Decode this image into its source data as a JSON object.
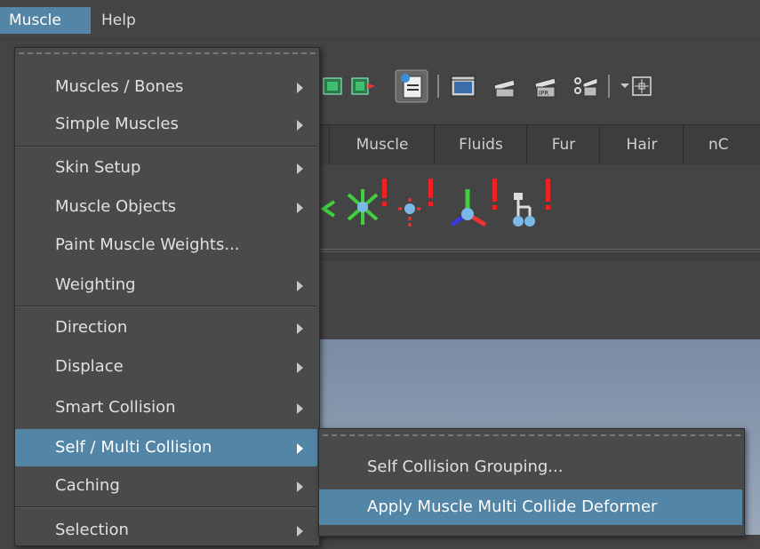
{
  "menubar": {
    "items": [
      {
        "label": "Muscle",
        "active": true
      },
      {
        "label": "Help",
        "active": false
      }
    ]
  },
  "shelf": {
    "tabs": [
      "Muscle",
      "Fluids",
      "Fur",
      "Hair",
      "nC"
    ]
  },
  "menu": {
    "items": [
      {
        "label": "Muscles / Bones",
        "submenu": true
      },
      {
        "label": "Simple Muscles",
        "submenu": true
      },
      {
        "label": "Skin Setup",
        "submenu": true
      },
      {
        "label": "Muscle Objects",
        "submenu": true
      },
      {
        "label": "Paint Muscle Weights...",
        "submenu": false
      },
      {
        "label": "Weighting",
        "submenu": true
      },
      {
        "label": "Direction",
        "submenu": true
      },
      {
        "label": "Displace",
        "submenu": true
      },
      {
        "label": "Smart Collision",
        "submenu": true
      },
      {
        "label": "Self / Multi Collision",
        "submenu": true,
        "highlighted": true
      },
      {
        "label": "Caching",
        "submenu": true
      },
      {
        "label": "Selection",
        "submenu": true
      }
    ]
  },
  "submenu": {
    "items": [
      {
        "label": "Self Collision Grouping..."
      },
      {
        "label": "Apply Muscle Multi Collide Deformer",
        "highlighted": true
      }
    ]
  },
  "colors": {
    "highlight": "#5285a6",
    "menu_bg": "#4a4a4a",
    "text": "#e0e0e0"
  }
}
